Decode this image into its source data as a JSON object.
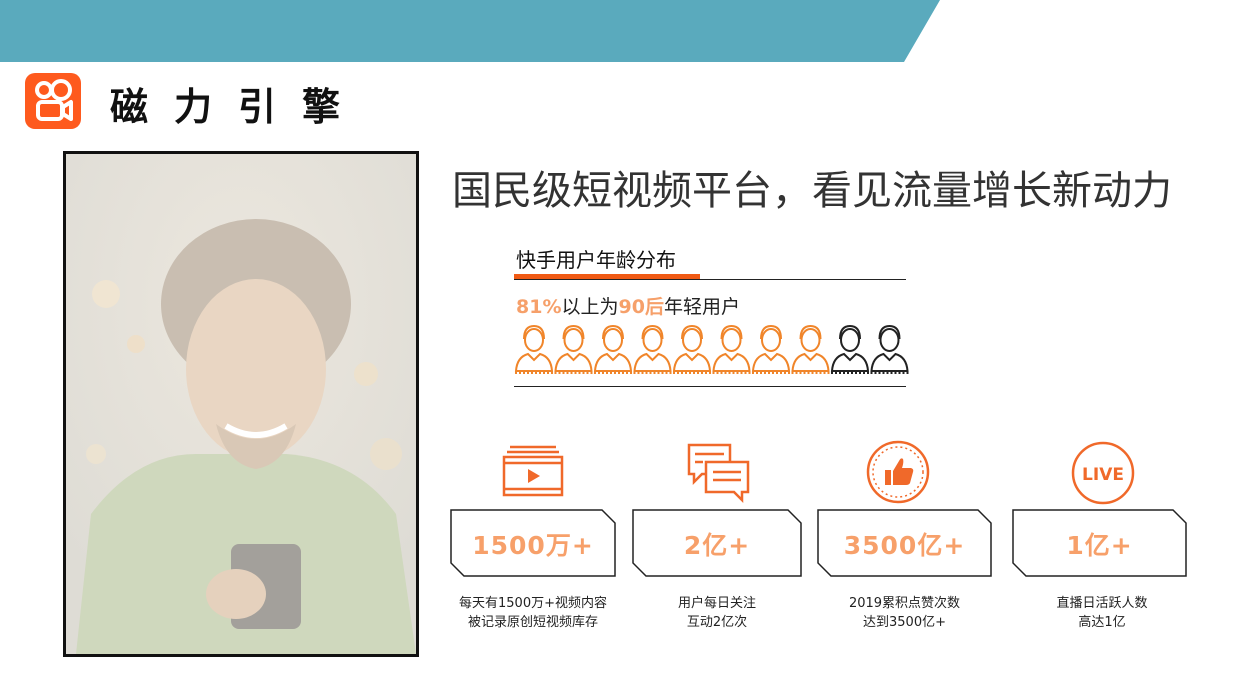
{
  "brand": {
    "name": "磁力引擎",
    "color": "#fe5a1e",
    "band_color": "#5aaabd"
  },
  "headline": "国民级短视频平台，看见流量增长新动力",
  "age_section": {
    "title": "快手用户年龄分布",
    "stat": {
      "pct": "81%",
      "mid": "以上为",
      "group": "90后",
      "tail": "年轻用户"
    },
    "people_total": 10,
    "people_highlighted": 8,
    "highlight_color": "#f0852a",
    "plain_color": "#222222"
  },
  "metrics": [
    {
      "icon": "video-play-icon",
      "value": "1500万+",
      "desc_line1": "每天有1500万+视频内容",
      "desc_line2": "被记录原创短视频库存"
    },
    {
      "icon": "chat-bubbles-icon",
      "value": "2亿+",
      "desc_line1": "用户每日关注",
      "desc_line2": "互动2亿次"
    },
    {
      "icon": "thumbs-up-icon",
      "value": "3500亿+",
      "desc_line1": "2019累积点赞次数",
      "desc_line2": "达到3500亿+"
    },
    {
      "icon": "live-badge-icon",
      "icon_text": "LIVE",
      "value": "1亿+",
      "desc_line1": "直播日活跃人数",
      "desc_line2": "高达1亿"
    }
  ]
}
